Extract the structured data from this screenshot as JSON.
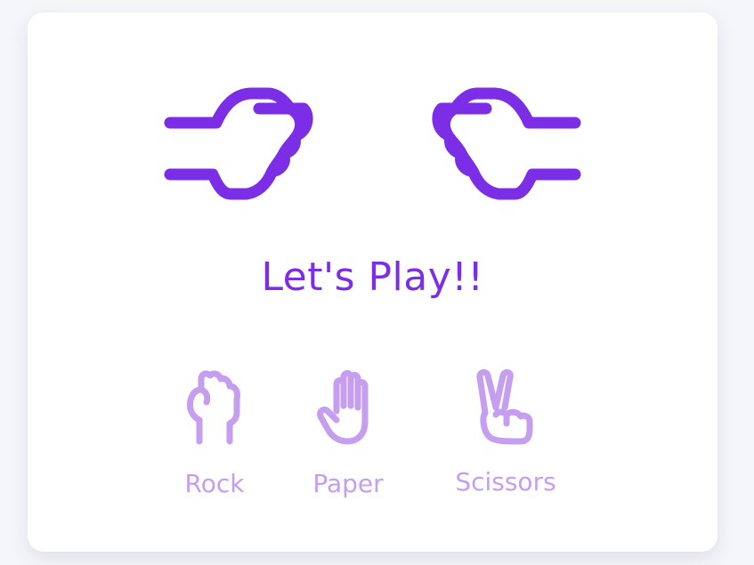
{
  "game": {
    "title": "Let's Play!!",
    "player_hand_icon": "fist-pointing-right-icon",
    "computer_hand_icon": "fist-pointing-left-icon"
  },
  "choices": [
    {
      "label": "Rock",
      "icon": "rock-hand-icon"
    },
    {
      "label": "Paper",
      "icon": "paper-hand-icon"
    },
    {
      "label": "Scissors",
      "icon": "scissors-hand-icon"
    }
  ],
  "colors": {
    "accent": "#7c2ee6",
    "choice": "#c59ef0",
    "background": "#f4f6fa",
    "card": "#ffffff"
  }
}
